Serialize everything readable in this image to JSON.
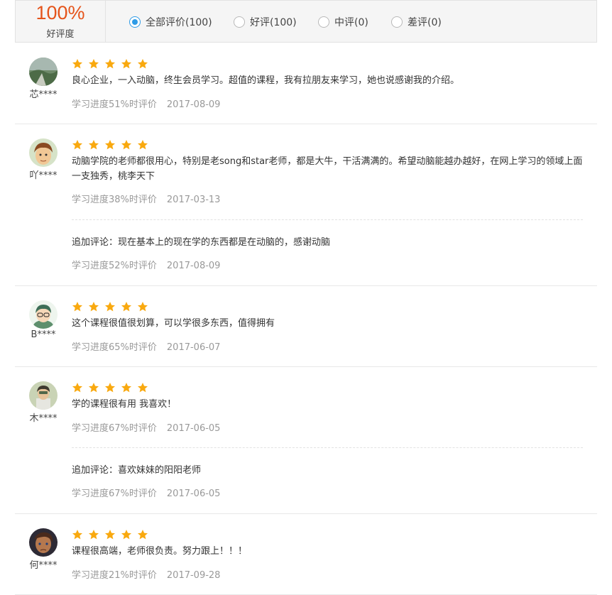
{
  "header": {
    "rate": "100%",
    "rate_label": "好评度",
    "filters": [
      {
        "label": "全部评价(100)",
        "checked": true
      },
      {
        "label": "好评(100)",
        "checked": false
      },
      {
        "label": "中评(0)",
        "checked": false
      },
      {
        "label": "差评(0)",
        "checked": false
      }
    ]
  },
  "colors": {
    "star": "#f9a90f",
    "accent": "#e5541b",
    "radio_active": "#2f9be6"
  },
  "reviews": [
    {
      "user": "芯****",
      "rating": 5,
      "text": "良心企业，一入动脑，终生会员学习。超值的课程，我有拉朋友来学习，她也说感谢我的介绍。",
      "progress": "学习进度51%时评价",
      "date": "2017-08-09"
    },
    {
      "user": "吖****",
      "rating": 5,
      "text": "动脑学院的老师都很用心，特别是老song和star老师，都是大牛，干活满满的。希望动脑能越办越好，在网上学习的领域上面一支独秀，桃李天下",
      "progress": "学习进度38%时评价",
      "date": "2017-03-13",
      "append": {
        "text": "追加评论：现在基本上的现在学的东西都是在动脑的，感谢动脑",
        "progress": "学习进度52%时评价",
        "date": "2017-08-09"
      }
    },
    {
      "user": "B****",
      "rating": 5,
      "text": "这个课程很值很划算，可以学很多东西，值得拥有",
      "progress": "学习进度65%时评价",
      "date": "2017-06-07"
    },
    {
      "user": "木****",
      "rating": 5,
      "text": "学的课程很有用 我喜欢！",
      "progress": "学习进度67%时评价",
      "date": "2017-06-05",
      "append": {
        "text": "追加评论：喜欢妹妹的阳阳老师",
        "progress": "学习进度67%时评价",
        "date": "2017-06-05"
      }
    },
    {
      "user": "何****",
      "rating": 5,
      "text": "课程很高端，老师很负责。努力跟上！！！",
      "progress": "学习进度21%时评价",
      "date": "2017-09-28"
    }
  ]
}
